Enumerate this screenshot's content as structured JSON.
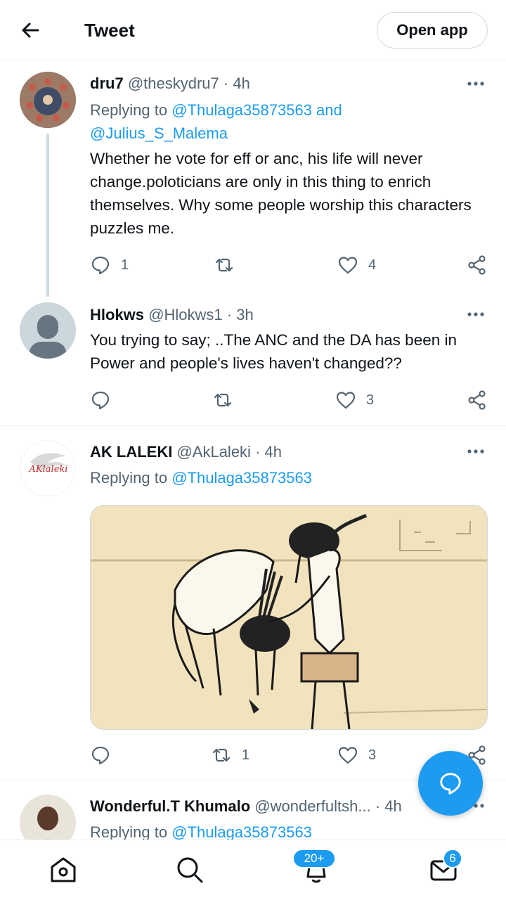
{
  "header": {
    "title": "Tweet",
    "open_app_label": "Open app"
  },
  "tweets": [
    {
      "name": "dru7",
      "handle": "@theskydru7",
      "time": "4h",
      "replying_prefix": "Replying to",
      "mentions": [
        "@Thulaga35873563",
        "and",
        "@Julius_S_Malema"
      ],
      "text": "Whether he vote for eff or anc, his life will never change.poloticians are only in this thing to enrich themselves. Why some people worship this characters puzzles me.",
      "replies": "1",
      "retweets": "",
      "likes": "4"
    },
    {
      "name": "Hlokws",
      "handle": "@Hlokws1",
      "time": "3h",
      "text": "You trying to say; ..The ANC and the DA has been in Power and people's lives haven't changed??",
      "replies": "",
      "retweets": "",
      "likes": "3"
    },
    {
      "name": "AK LALEKI",
      "handle": "@AkLaleki",
      "time": "4h",
      "replying_prefix": "Replying to",
      "mentions": [
        "@Thulaga35873563"
      ],
      "avatar_text": "AKlaleki",
      "replies": "",
      "retweets": "1",
      "likes": "3"
    },
    {
      "name": "Wonderful.T Khumalo",
      "handle": "@wonderfultsh...",
      "time": "4h",
      "replying_prefix": "Replying to",
      "mentions": [
        "@Thulaga35873563"
      ]
    }
  ],
  "bottom_nav": {
    "notifications_badge": "20+",
    "messages_badge": "6"
  },
  "colors": {
    "accent": "#1d9bf0",
    "text": "#0f1419",
    "muted": "#536471",
    "border": "#eff3f4"
  },
  "icons": [
    "back-arrow-icon",
    "more-icon",
    "reply-icon",
    "retweet-icon",
    "like-icon",
    "share-icon",
    "compose-reply-icon",
    "home-icon",
    "search-icon",
    "notifications-icon",
    "messages-icon"
  ]
}
